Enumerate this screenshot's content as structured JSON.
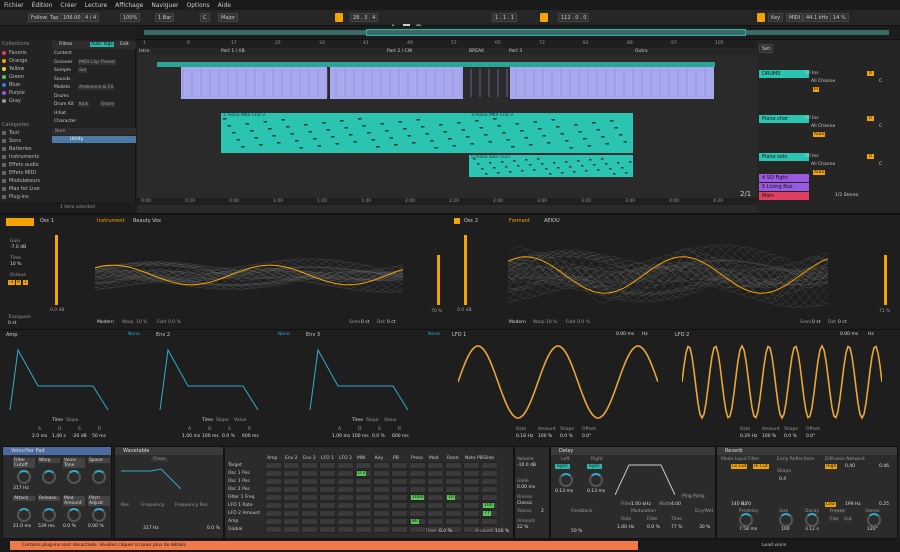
{
  "menu": [
    "Fichier",
    "Édition",
    "Créer",
    "Lecture",
    "Affichage",
    "Naviguer",
    "Options",
    "Aide"
  ],
  "transport": {
    "follow": "Follow",
    "tap": "Tap",
    "tempo": "106.00",
    "sig": "4 / 4",
    "zoom": "100%",
    "bar": "1 Bar",
    "key": "C",
    "scale": "Major",
    "position": "28 . 3 . 4",
    "loop_start": "1 . 1 . 1",
    "loop_len": "112 . 0 . 0",
    "key_label": "Key",
    "midi_label": "MIDI",
    "sample_rate": "44.1 kHz",
    "cpu": "14 %"
  },
  "browser": {
    "tabs": [
      "Filtres",
      "Auto Tags",
      "Edit"
    ],
    "collections_title": "Collections",
    "collections": [
      {
        "label": "Favoris",
        "color": "#e0404a"
      },
      {
        "label": "Orange",
        "color": "#f5a300"
      },
      {
        "label": "Yellow",
        "color": "#e7d43a"
      },
      {
        "label": "Green",
        "color": "#5cc65a"
      },
      {
        "label": "Blue",
        "color": "#3a7be0"
      },
      {
        "label": "Purple",
        "color": "#9b59e0"
      },
      {
        "label": "Gray",
        "color": "#999999"
      }
    ],
    "categories_title": "Catégories",
    "categories": [
      "Tout",
      "Sons",
      "Batteries",
      "Instruments",
      "Effets audio",
      "Effets MIDI",
      "Modulateurs",
      "Max for Live",
      "Plug-ins"
    ],
    "filter_rows": [
      {
        "label": "Content",
        "tags": []
      },
      {
        "label": "Grooves",
        "tags": [
          "MIDI Clip",
          "Preset"
        ]
      },
      {
        "label": "Sample",
        "tags": [
          "Set"
        ]
      },
      {
        "label": "Sounds",
        "tags": []
      },
      {
        "label": "Mallets",
        "tags": [
          "Ambience & FX"
        ]
      },
      {
        "label": "Drums",
        "tags": []
      },
      {
        "label": "Drum Kit",
        "tags": [
          "Kick",
          "Snare"
        ]
      },
      {
        "label": "Hihat",
        "tags": []
      },
      {
        "label": "Character",
        "tags": []
      }
    ],
    "col_header": "Nom",
    "selected_item": "Utility",
    "status": "1 item selected"
  },
  "arrangement": {
    "ruler": [
      "1",
      "9",
      "17",
      "25",
      "33",
      "41",
      "49",
      "57",
      "65",
      "73",
      "81",
      "89",
      "97",
      "105"
    ],
    "locators": [
      "Intro",
      "Part 1 / AB",
      "Part 2 / CW",
      "BREAK",
      "Part 3",
      "Outro"
    ],
    "time_ticks": [
      "0:00",
      "0:20",
      "0:40",
      "1:00",
      "1:20",
      "1:40",
      "2:00",
      "2:20",
      "2:40",
      "3:00",
      "3:20",
      "3:40",
      "4:00",
      "4:20"
    ],
    "clips": [
      {
        "label": "1 Piano MKII Chd 3",
        "color": "#2bc4b0"
      },
      {
        "label": "2 Piano MKII Chd 3",
        "color": "#2bc4b0"
      },
      {
        "label": "3 Piano MKII Chd 3",
        "color": "#2bc4b0"
      },
      {
        "label": "4 Piano MKII Chd 3",
        "color": "#2bc4b0"
      },
      {
        "label": "5 Piano solo TEST",
        "color": "#2bc4b0"
      }
    ],
    "bar_count": "2/1"
  },
  "mixer": {
    "set_label": "Set",
    "tracks": [
      {
        "name": "DRUMS",
        "color": "#2bc4b0",
        "input": "All Ins",
        "chan": "All Channe",
        "mon": "In",
        "vol": "0",
        "pan": "C"
      },
      {
        "name": "Piano chor",
        "color": "#2bc4b0",
        "input": "All Ins",
        "chan": "All Channe",
        "mon": "Auto",
        "vol": "0",
        "pan": "C"
      },
      {
        "name": "Piano solo",
        "color": "#2bc4b0",
        "input": "All Ins",
        "chan": "All Channe",
        "mon": "Auto",
        "vol": "0",
        "pan": "C"
      },
      {
        "name": "4 SQ Fight",
        "color": "#9b59e0"
      },
      {
        "name": "5 Living Roo",
        "color": "#9b59e0"
      },
      {
        "name": "Main",
        "color": "#e04060"
      }
    ],
    "main_out": "1/2 Stereo"
  },
  "osc1": {
    "title": "Osc 1",
    "type_label": "Instrument",
    "type_value": "Beauty Vox",
    "gain_label": "Gain",
    "gain": "-7.0 dB",
    "time_label": "Time",
    "time": "10 %",
    "octave_label": "Octave",
    "octaves": [
      "-1",
      "0",
      "1"
    ],
    "transpose_label": "Transpose",
    "transpose": "0 st",
    "level": "0.0 dB",
    "mode": "Modern",
    "warp_label": "Warp",
    "warp": "10 %",
    "fold_label": "Fold",
    "fold": "0.0 %",
    "semi_label": "Semi",
    "semi": "0 st",
    "det_label": "Det",
    "det": "0 ct",
    "right_pct": "70 %"
  },
  "osc2": {
    "title": "Osc 2",
    "type_label": "Formant",
    "type_value": "AEIOU",
    "level": "0.0 dB",
    "mode": "Modern",
    "warp_label": "Warp",
    "warp": "10 %",
    "fold_label": "Fold",
    "fold": "0.0 %",
    "semi_label": "Semi",
    "semi": "0 st",
    "det_label": "Det",
    "det": "0 ct",
    "right_pct": "71 %"
  },
  "envs": [
    {
      "title": "Amp",
      "mode": "None",
      "adsr": [
        "A",
        "D",
        "S",
        "R"
      ],
      "vals": [
        "2.0 ms",
        "1.40 s",
        "-20 dB",
        "50 ms"
      ],
      "time": "Time",
      "slope": "Slope"
    },
    {
      "title": "Env 2",
      "mode": "None",
      "adsr": [
        "A",
        "D",
        "S",
        "R"
      ],
      "vals": [
        "1.00 ms",
        "100 ms",
        "0.0 %",
        "600 ms"
      ],
      "time": "Time",
      "slope": "Slope",
      "value": "Value"
    },
    {
      "title": "Env 3",
      "mode": "None",
      "adsr": [
        "A",
        "D",
        "S",
        "R"
      ],
      "vals": [
        "1.00 ms",
        "100 ms",
        "0.0 %",
        "600 ms"
      ],
      "time": "Time",
      "slope": "Slope",
      "value": "Value"
    }
  ],
  "lfos": [
    {
      "title": "LFO 1",
      "a": "0.00 ms",
      "hz": "Hz",
      "rate_label": "Rate",
      "rate": "0.18 Hz",
      "amount_label": "Amount",
      "amount": "100 %",
      "shape_label": "Shape",
      "shape": "0.0 %",
      "offset_label": "Offset",
      "offset": "0.0°"
    },
    {
      "title": "LFO 2",
      "a": "0.00 ms",
      "hz": "Hz",
      "rate_label": "Rate",
      "rate": "0.29 Hz",
      "amount_label": "Amount",
      "amount": "100 %",
      "shape_label": "Shape",
      "shape": "0.0 %",
      "offset_label": "Offset",
      "offset": "0.0°"
    }
  ],
  "devices": {
    "rack_title": "Velocifier Pad",
    "rack_knobs": [
      "Filter Cutoff",
      "Warp",
      "Voice Tone",
      "Space",
      "Attack",
      "Release",
      "Mod Amount",
      "Pitch Adjust"
    ],
    "rack_vals": [
      "317 Hz",
      "",
      "",
      "",
      "21.0 ms",
      "539 ms",
      "0.0 %",
      "0.00 %"
    ],
    "wavetable_title": "Wavetable",
    "filter_type": "Clean",
    "res_label": "Res",
    "freq_label": "Frequency",
    "freqres_label": "Frequency Res",
    "freq": "317 Hz",
    "res": "0.0 %",
    "mod_cols": [
      "Amp",
      "Env 2",
      "Env 3",
      "LFO 1",
      "LFO 2",
      "MW",
      "Key",
      "PB",
      "Press",
      "Mod",
      "Rand",
      "Note PB",
      "Slide"
    ],
    "mod_rows": [
      "Target",
      "Osc 1 Pos",
      "Osc 1 Pos",
      "Osc 2 Pos",
      "Filter 1 Freq",
      "LFO 1 Rate",
      "LFO 2 Amount",
      "Amp",
      "Global"
    ],
    "mod_vals": [
      "0.3",
      "1000",
      "10",
      "100",
      "10",
      "77",
      "80"
    ],
    "mod_time_label": "Time",
    "mod_time": "0.0 %",
    "mod_amount_label": "Amount",
    "mod_amount": "100 %",
    "volume_label": "Volume",
    "volume": "-10.0 dB",
    "glide_label": "Glide",
    "glide": "0.00 ms",
    "unison_label": "Unison",
    "unison": "Classic",
    "voices_label": "Voices",
    "voices": "2",
    "amount_label": "Amount",
    "amount": "22 %",
    "delay_title": "Delay",
    "left": "Left",
    "right": "Right",
    "sync": "Sync",
    "left_val": "0.13 ms",
    "right_val": "0.13 ms",
    "feedback_label": "Feedback",
    "feedback": "50 %",
    "pingpong": "Ping Pong",
    "filter_label": "Filter",
    "filter_val": "1.00 kHz",
    "width_label": "Width",
    "width_val": "4.00",
    "modulation_label": "Modulation",
    "rate_label": "Rate",
    "rate": "1.00 Hz",
    "filter2": "Filter",
    "filter2_val": "0.0 %",
    "time_label": "Time",
    "time_val": "77 %",
    "drywet": "Dry/Wet",
    "drywet_val": "30 %",
    "reverb_title": "Reverb",
    "input_filter": "Input Filter",
    "early": "Early Reflections",
    "diffusion": "Diffusion Network",
    "hi_cut": "Hi Cut",
    "lo_cut": "Lo Cut",
    "mode_label": "Mode",
    "freeze": "Freeze",
    "flat": "Flat",
    "cut": "Cut",
    "reflect_label": "Reflect",
    "reflect": "0.0 %",
    "chorus_label": "Chorus",
    "size_label": "Size",
    "size": "100",
    "decay_label": "Decay",
    "decay": "3.12 s",
    "high_label": "High",
    "high": "0.40",
    "low_label": "Low",
    "low": "199 Hz",
    "lfreq": "0.46",
    "pre_label": "Predelay",
    "pre": "7.58 ms",
    "dens": "0.25",
    "stereo_label": "Stereo",
    "stereo": "120°",
    "freq2": "6.70",
    "freq3": "140 Hz",
    "shape_label": "Shape",
    "shape": "0.4"
  },
  "status": {
    "message": "Certains plug-ins sont désactivés. Veuillez cliquer ici pour plus de détails",
    "right": "Lead voice"
  }
}
